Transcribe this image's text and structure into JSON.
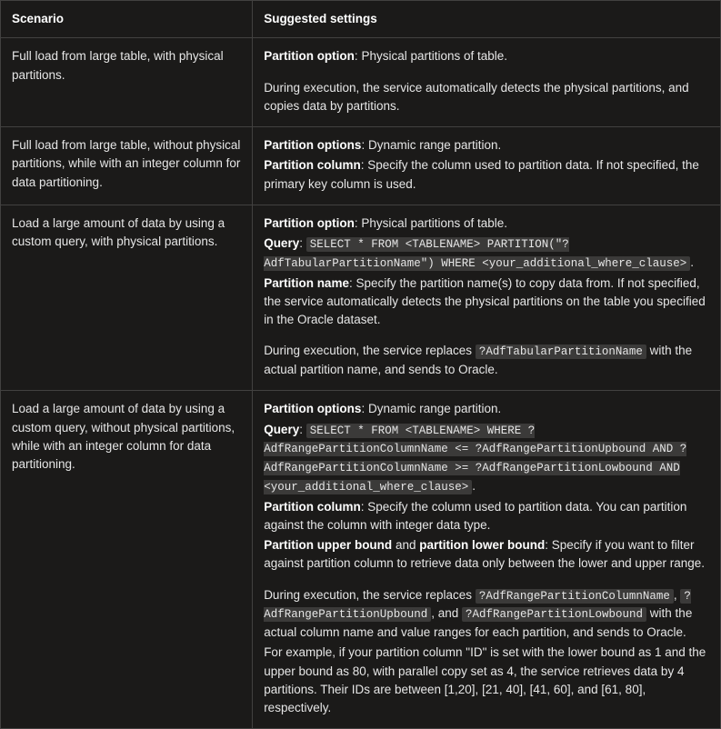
{
  "header": {
    "scenario": "Scenario",
    "suggested": "Suggested settings"
  },
  "rows": [
    {
      "scenario": "Full load from large table, with physical partitions.",
      "opt_label": "Partition option",
      "opt_val": " Physical partitions of table.",
      "exec": "During execution, the service automatically detects the physical partitions, and copies data by partitions."
    },
    {
      "scenario": "Full load from large table, without physical partitions, while with an integer column for data partitioning.",
      "opts_label": "Partition options",
      "opts_val": ": Dynamic range partition.",
      "col_label": "Partition column",
      "col_val": ": Specify the column used to partition data. If not specified, the primary key column is used."
    },
    {
      "scenario": "Load a large amount of data by using a custom query, with physical partitions.",
      "opt_label": "Partition option",
      "opt_val": ": Physical partitions of table.",
      "q_label": "Query",
      "q_code": "SELECT * FROM <TABLENAME> PARTITION(\"?AdfTabularPartitionName\") WHERE <your_additional_where_clause>",
      "pname_label": "Partition name",
      "pname_val": ": Specify the partition name(s) to copy data from. If not specified, the service automatically detects the physical partitions on the table you specified in the Oracle dataset.",
      "exec_pre": "During execution, the service replaces ",
      "exec_code": "?AdfTabularPartitionName",
      "exec_post": " with the actual partition name, and sends to Oracle."
    },
    {
      "scenario": "Load a large amount of data by using a custom query, without physical partitions, while with an integer column for data partitioning.",
      "opts_label": "Partition options",
      "opts_val": ": Dynamic range partition.",
      "q_label": "Query",
      "q_code": "SELECT * FROM <TABLENAME> WHERE ?AdfRangePartitionColumnName <= ?AdfRangePartitionUpbound AND ?AdfRangePartitionColumnName >= ?AdfRangePartitionLowbound AND <your_additional_where_clause>",
      "col_label": "Partition column",
      "col_val": ": Specify the column used to partition data. You can partition against the column with integer data type.",
      "ub_label": "Partition upper bound",
      "and_word": " and ",
      "lb_label": "partition lower bound",
      "bounds_val": ": Specify if you want to filter against partition column to retrieve data only between the lower and upper range.",
      "exec_pre": "During execution, the service replaces ",
      "exec_c1": "?AdfRangePartitionColumnName",
      "exec_sep1": ", ",
      "exec_c2": "?AdfRangePartitionUpbound",
      "exec_sep2": ", and ",
      "exec_c3": "?AdfRangePartitionLowbound",
      "exec_post": " with the actual column name and value ranges for each partition, and sends to Oracle.",
      "example": "For example, if your partition column \"ID\" is set with the lower bound as 1 and the upper bound as 80, with parallel copy set as 4, the service retrieves data by 4 partitions. Their IDs are between [1,20], [21, 40], [41, 60], and [61, 80], respectively."
    }
  ]
}
